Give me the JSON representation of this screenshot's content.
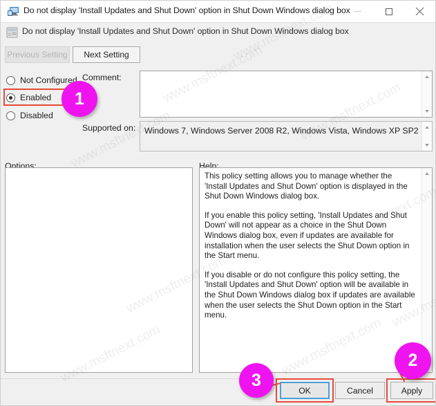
{
  "window": {
    "title": "Do not display 'Install Updates and Shut Down' option in Shut Down Windows dialog box",
    "icon": "policy-setting-icon",
    "controls": {
      "minimize": "minimize-icon",
      "maximize": "maximize-icon",
      "close": "✕"
    }
  },
  "header": {
    "icon": "group-policy-icon",
    "title": "Do not display 'Install Updates and Shut Down' option in Shut Down Windows dialog box",
    "previous_setting": "Previous Setting",
    "next_setting": "Next Setting"
  },
  "state": {
    "options": [
      {
        "id": "not-configured",
        "label": "Not Configured",
        "selected": false
      },
      {
        "id": "enabled",
        "label": "Enabled",
        "selected": true
      },
      {
        "id": "disabled",
        "label": "Disabled",
        "selected": false
      }
    ]
  },
  "fields": {
    "comment_label": "Comment:",
    "comment_value": "",
    "supported_label": "Supported on:",
    "supported_value": "Windows 7, Windows Server 2008 R2, Windows Vista, Windows XP SP2"
  },
  "panels": {
    "options_label": "Options:",
    "options_value": "",
    "help_label": "Help:",
    "help_paragraphs": [
      "This policy setting allows you to manage whether the 'Install Updates and Shut Down' option is displayed in the Shut Down Windows dialog box.",
      "If you enable this policy setting, 'Install Updates and Shut Down' will not appear as a choice in the Shut Down Windows dialog box, even if updates are available for installation when the user selects the Shut Down option in the Start menu.",
      "If you disable or do not configure this policy setting, the 'Install Updates and Shut Down' option will be available in the Shut Down Windows dialog box if updates are available when the user selects the Shut Down option in the Start menu."
    ]
  },
  "footer": {
    "ok": "OK",
    "cancel": "Cancel",
    "apply": "Apply"
  },
  "annotations": {
    "accent_color": "#ef14ef",
    "box_color": "#e8493a",
    "steps": [
      {
        "number": "1",
        "target": "Enabled"
      },
      {
        "number": "2",
        "target": "Apply"
      },
      {
        "number": "3",
        "target": "OK"
      }
    ]
  },
  "watermark": {
    "text": "www.msftnext.com"
  }
}
